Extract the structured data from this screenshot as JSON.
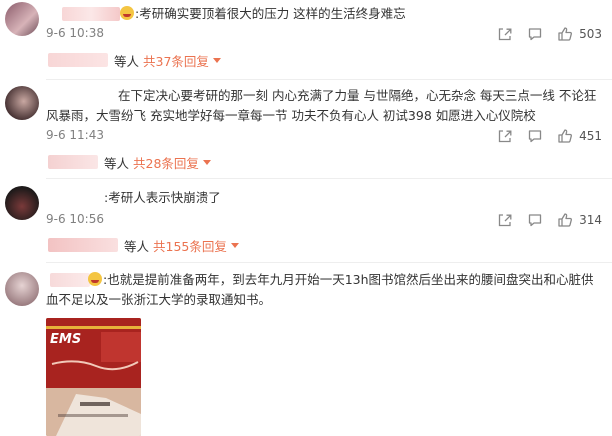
{
  "comments": [
    {
      "text": ":考研确实要顶着很大的压力 这样的生活终身难忘",
      "time": "9-6 10:38",
      "reply_prefix": "等人",
      "reply_link": "共37条回复",
      "likes": "503"
    },
    {
      "text": "在下定决心要考研的那一刻 内心充满了力量 与世隔绝，心无杂念 每天三点一线 不论狂风暴雨，大雪纷飞 充实地学好每一章每一节 功夫不负有心人 初试398 如愿进入心仪院校",
      "time": "9-6 11:43",
      "reply_prefix": "等人",
      "reply_link": "共28条回复",
      "likes": "451"
    },
    {
      "text": ":考研人表示快崩溃了",
      "time": "9-6 10:56",
      "reply_prefix": "等人",
      "reply_link": "共155条回复",
      "likes": "314"
    },
    {
      "text": ":也就是提前准备两年，到去年九月开始一天13h图书馆然后坐出来的腰间盘突出和心脏供血不足以及一张浙江大学的录取通知书。",
      "photo_label": "EMS"
    }
  ],
  "colors": {
    "reply_link": "#eb7350",
    "meta": "#808080",
    "text": "#333333"
  },
  "icons": [
    "share-icon",
    "comment-icon",
    "like-icon",
    "chevron-down-icon"
  ]
}
